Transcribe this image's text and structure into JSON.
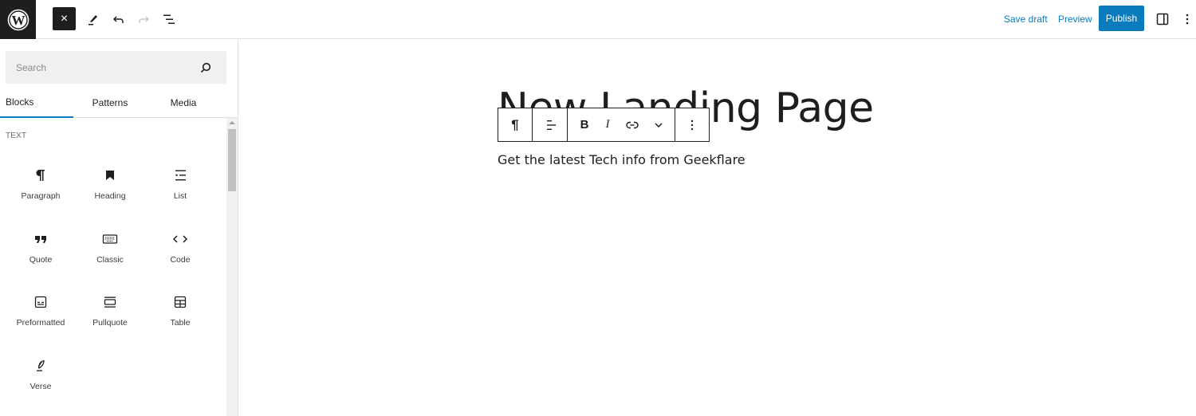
{
  "topbar": {
    "logo": "wordpress-logo",
    "close_label": "×",
    "save_draft": "Save draft",
    "preview": "Preview",
    "publish": "Publish"
  },
  "sidebar": {
    "search_placeholder": "Search",
    "tabs": [
      {
        "label": "Blocks",
        "active": true
      },
      {
        "label": "Patterns",
        "active": false
      },
      {
        "label": "Media",
        "active": false
      }
    ],
    "section_title": "TEXT",
    "blocks": [
      {
        "label": "Paragraph",
        "icon": "paragraph-icon"
      },
      {
        "label": "Heading",
        "icon": "heading-icon"
      },
      {
        "label": "List",
        "icon": "list-icon"
      },
      {
        "label": "Quote",
        "icon": "quote-icon"
      },
      {
        "label": "Classic",
        "icon": "keyboard-icon"
      },
      {
        "label": "Code",
        "icon": "code-icon"
      },
      {
        "label": "Preformatted",
        "icon": "preformatted-icon"
      },
      {
        "label": "Pullquote",
        "icon": "pullquote-icon"
      },
      {
        "label": "Table",
        "icon": "table-icon"
      },
      {
        "label": "Verse",
        "icon": "verse-icon"
      }
    ]
  },
  "editor": {
    "title": "New Landing Page",
    "paragraph": "Get the latest Tech info from Geekflare",
    "toolbar": {
      "block_type": "¶",
      "bold": "B",
      "italic": "I"
    }
  },
  "colors": {
    "accent": "#0a7bbd",
    "dark": "#1e1e1e"
  }
}
